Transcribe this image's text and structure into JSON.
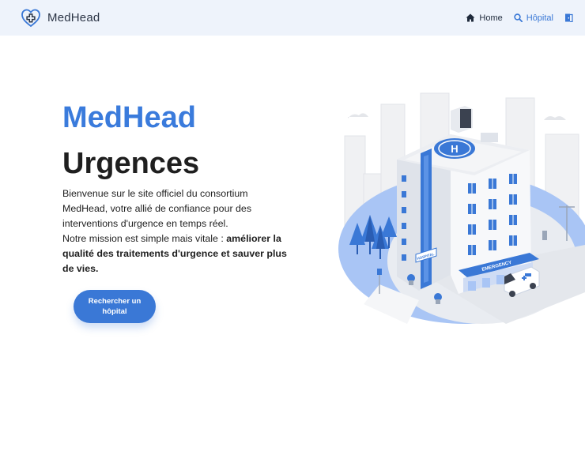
{
  "navbar": {
    "brand": "MedHead",
    "links": {
      "home": "Home",
      "hospital": "Hôpital"
    }
  },
  "hero": {
    "title": "MedHead",
    "subtitle": "Urgences",
    "intro": "Bienvenue sur le site officiel du consortium MedHead, votre allié de confiance pour des interventions d'urgence en temps réel.",
    "mission_prefix": "Notre mission est simple mais vitale : ",
    "mission_bold": "améliorer la qualité des traitements d'urgence et sauver plus de vies.",
    "cta_label": "Rechercher un hôpital"
  },
  "illustration": {
    "building_sign": "HOSPITAL",
    "emergency_sign": "EMERGENCY"
  },
  "colors": {
    "accent": "#3a78d6",
    "navbar_bg": "#eef3fb",
    "heading_dark": "#1f1f1f"
  }
}
